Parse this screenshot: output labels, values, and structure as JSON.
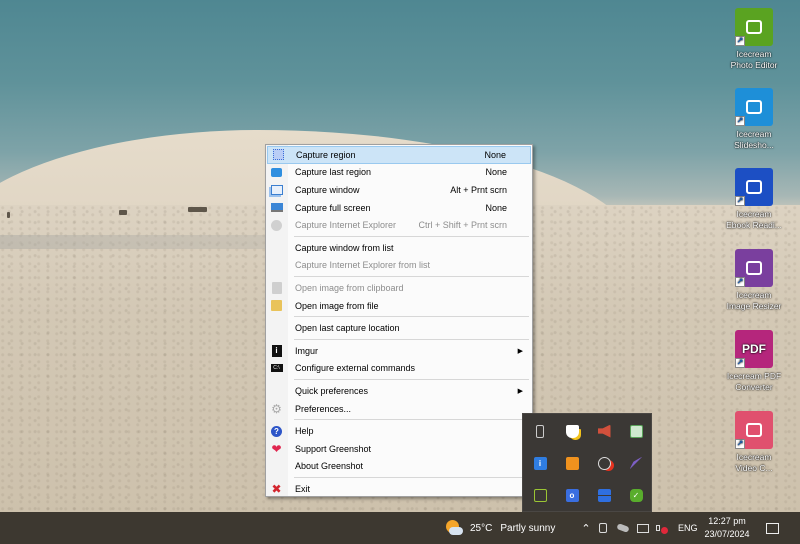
{
  "desktop": {
    "icons": [
      {
        "label_line1": "Icecream",
        "label_line2": "Photo Editor",
        "icon": "camera-icon",
        "color": "#5aa321"
      },
      {
        "label_line1": "Icecream",
        "label_line2": "Slidesho...",
        "icon": "slideshow-icon",
        "color": "#1e8fd8"
      },
      {
        "label_line1": "Icecream",
        "label_line2": "Ebook Readi...",
        "icon": "book-icon",
        "color": "#1c4fc4"
      },
      {
        "label_line1": "Icecream",
        "label_line2": "Image Resizer",
        "icon": "resize-icon",
        "color": "#7a3f9e"
      },
      {
        "label_line1": "Icecream PDF",
        "label_line2": "Converter",
        "icon": "pdf-icon",
        "color": "#b5267c",
        "glyph": "PDF"
      },
      {
        "label_line1": "Icecream",
        "label_line2": "Video C...",
        "icon": "video-convert-icon",
        "color": "#e0506e"
      }
    ]
  },
  "context_menu": {
    "groups": [
      [
        {
          "label": "Capture region",
          "shortcut": "None",
          "icon": "capture-region-icon",
          "disabled": false,
          "selected": true
        },
        {
          "label": "Capture last region",
          "shortcut": "None",
          "icon": "capture-last-region-icon",
          "disabled": false
        },
        {
          "label": "Capture window",
          "shortcut": "Alt + Prnt scrn",
          "icon": "capture-window-icon",
          "disabled": false
        },
        {
          "label": "Capture full screen",
          "shortcut": "None",
          "icon": "monitor-icon",
          "disabled": false
        },
        {
          "label": "Capture Internet Explorer",
          "shortcut": "Ctrl + Shift + Prnt scrn",
          "icon": "internet-explorer-icon",
          "disabled": true
        }
      ],
      [
        {
          "label": "Capture window from list",
          "disabled": false
        },
        {
          "label": "Capture Internet Explorer from list",
          "disabled": true
        }
      ],
      [
        {
          "label": "Open image from clipboard",
          "icon": "clipboard-icon",
          "disabled": true
        },
        {
          "label": "Open image from file",
          "icon": "folder-icon",
          "disabled": false
        }
      ],
      [
        {
          "label": "Open last capture location",
          "disabled": false
        }
      ],
      [
        {
          "label": "Imgur",
          "icon": "imgur-icon",
          "submenu": true,
          "disabled": false
        },
        {
          "label": "Configure external commands",
          "icon": "command-line-icon",
          "disabled": false
        }
      ],
      [
        {
          "label": "Quick preferences",
          "submenu": true,
          "disabled": false
        },
        {
          "label": "Preferences...",
          "icon": "gear-icon",
          "disabled": false
        }
      ],
      [
        {
          "label": "Help",
          "icon": "help-icon",
          "disabled": false
        },
        {
          "label": "Support Greenshot",
          "icon": "heart-icon",
          "disabled": false
        },
        {
          "label": "About Greenshot",
          "disabled": false
        }
      ],
      [
        {
          "label": "Exit",
          "icon": "exit-icon",
          "disabled": false
        }
      ]
    ]
  },
  "tray_overflow": {
    "icons": [
      "usb-drive-icon",
      "security-warning-icon",
      "speaker-icon",
      "network-monitor-icon",
      "info-icon",
      "orange-app-icon",
      "record-icon",
      "feather-icon",
      "green-arrows-icon",
      "camera-app-icon",
      "grid-app-icon",
      "greenshot-check-icon"
    ]
  },
  "taskbar": {
    "weather": {
      "temp": "25°C",
      "condition": "Partly sunny"
    },
    "language": "ENG",
    "time": "12:27 pm",
    "date": "23/07/2024"
  }
}
